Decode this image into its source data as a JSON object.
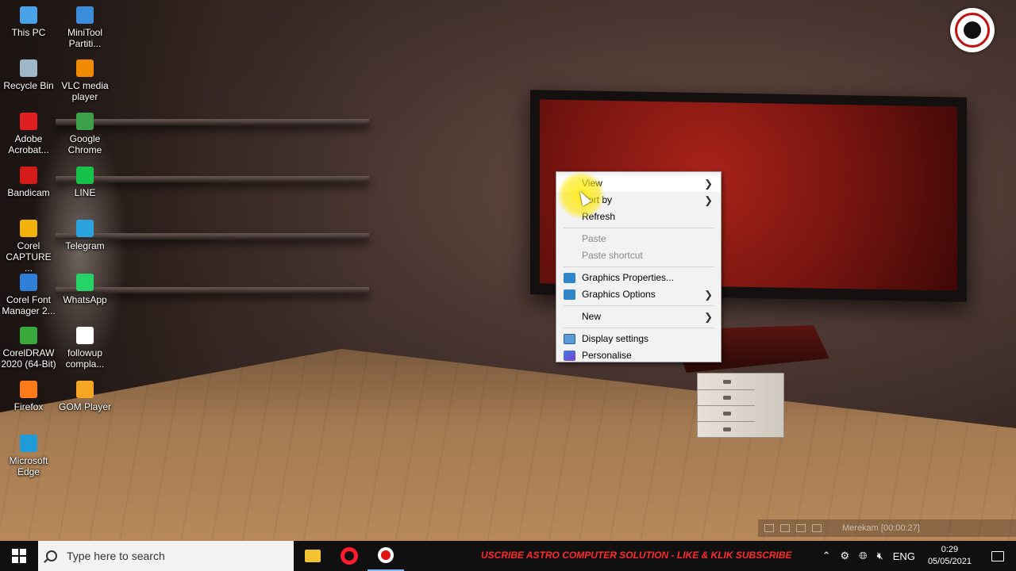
{
  "desktop_icons": [
    {
      "label": "This PC",
      "icon": "this-pc-icon",
      "color": "#4aa3e8"
    },
    {
      "label": "MiniTool\nPartiti...",
      "icon": "minitool-icon",
      "color": "#3c8dd9"
    },
    {
      "label": "Recycle Bin",
      "icon": "recycle-bin-icon",
      "color": "#9fb6c8"
    },
    {
      "label": "VLC media\nplayer",
      "icon": "vlc-icon",
      "color": "#f08a00"
    },
    {
      "label": "Adobe\nAcrobat...",
      "icon": "acrobat-icon",
      "color": "#e02020"
    },
    {
      "label": "Google\nChrome",
      "icon": "chrome-icon",
      "color": "#3ca14a"
    },
    {
      "label": "Bandicam",
      "icon": "bandicam-icon",
      "color": "#d51a1a"
    },
    {
      "label": "LINE",
      "icon": "line-icon",
      "color": "#17c24b"
    },
    {
      "label": "Corel\nCAPTURE ...",
      "icon": "corel-capture-icon",
      "color": "#f2b20a"
    },
    {
      "label": "Telegram",
      "icon": "telegram-icon",
      "color": "#2aa3df"
    },
    {
      "label": "Corel Font\nManager 2...",
      "icon": "corel-font-icon",
      "color": "#2f7fd8"
    },
    {
      "label": "WhatsApp",
      "icon": "whatsapp-icon",
      "color": "#25d366"
    },
    {
      "label": "CorelDRAW\n2020 (64-Bit)",
      "icon": "coreldraw-icon",
      "color": "#3aa83a"
    },
    {
      "label": "followup\ncompla...",
      "icon": "document-icon",
      "color": "#ffffff"
    },
    {
      "label": "Firefox",
      "icon": "firefox-icon",
      "color": "#ff7a1a"
    },
    {
      "label": "GOM Player",
      "icon": "gom-player-icon",
      "color": "#f5a623"
    },
    {
      "label": "Microsoft\nEdge",
      "icon": "edge-icon",
      "color": "#1f9bd7"
    }
  ],
  "context_menu": {
    "view": "View",
    "sort_by": "Sort by",
    "refresh": "Refresh",
    "paste": "Paste",
    "paste_shortcut": "Paste shortcut",
    "graphics_properties": "Graphics Properties...",
    "graphics_options": "Graphics Options",
    "new": "New",
    "display_settings": "Display settings",
    "personalise": "Personalise"
  },
  "recorder": {
    "status": "Merekam [00:00:27]"
  },
  "taskbar": {
    "search_placeholder": "Type here to search",
    "marquee": "USCRIBE   ASTRO COMPUTER SOLUTION - LIKE & KLIK SUBSCRIBE",
    "language": "ENG",
    "time": "0:29",
    "date": "05/05/2021"
  },
  "colors": {
    "taskbar_bg": "#101010",
    "menu_bg": "#f2f2f2",
    "marquee": "#ff2a2a",
    "highlight": "#ffeb00"
  }
}
